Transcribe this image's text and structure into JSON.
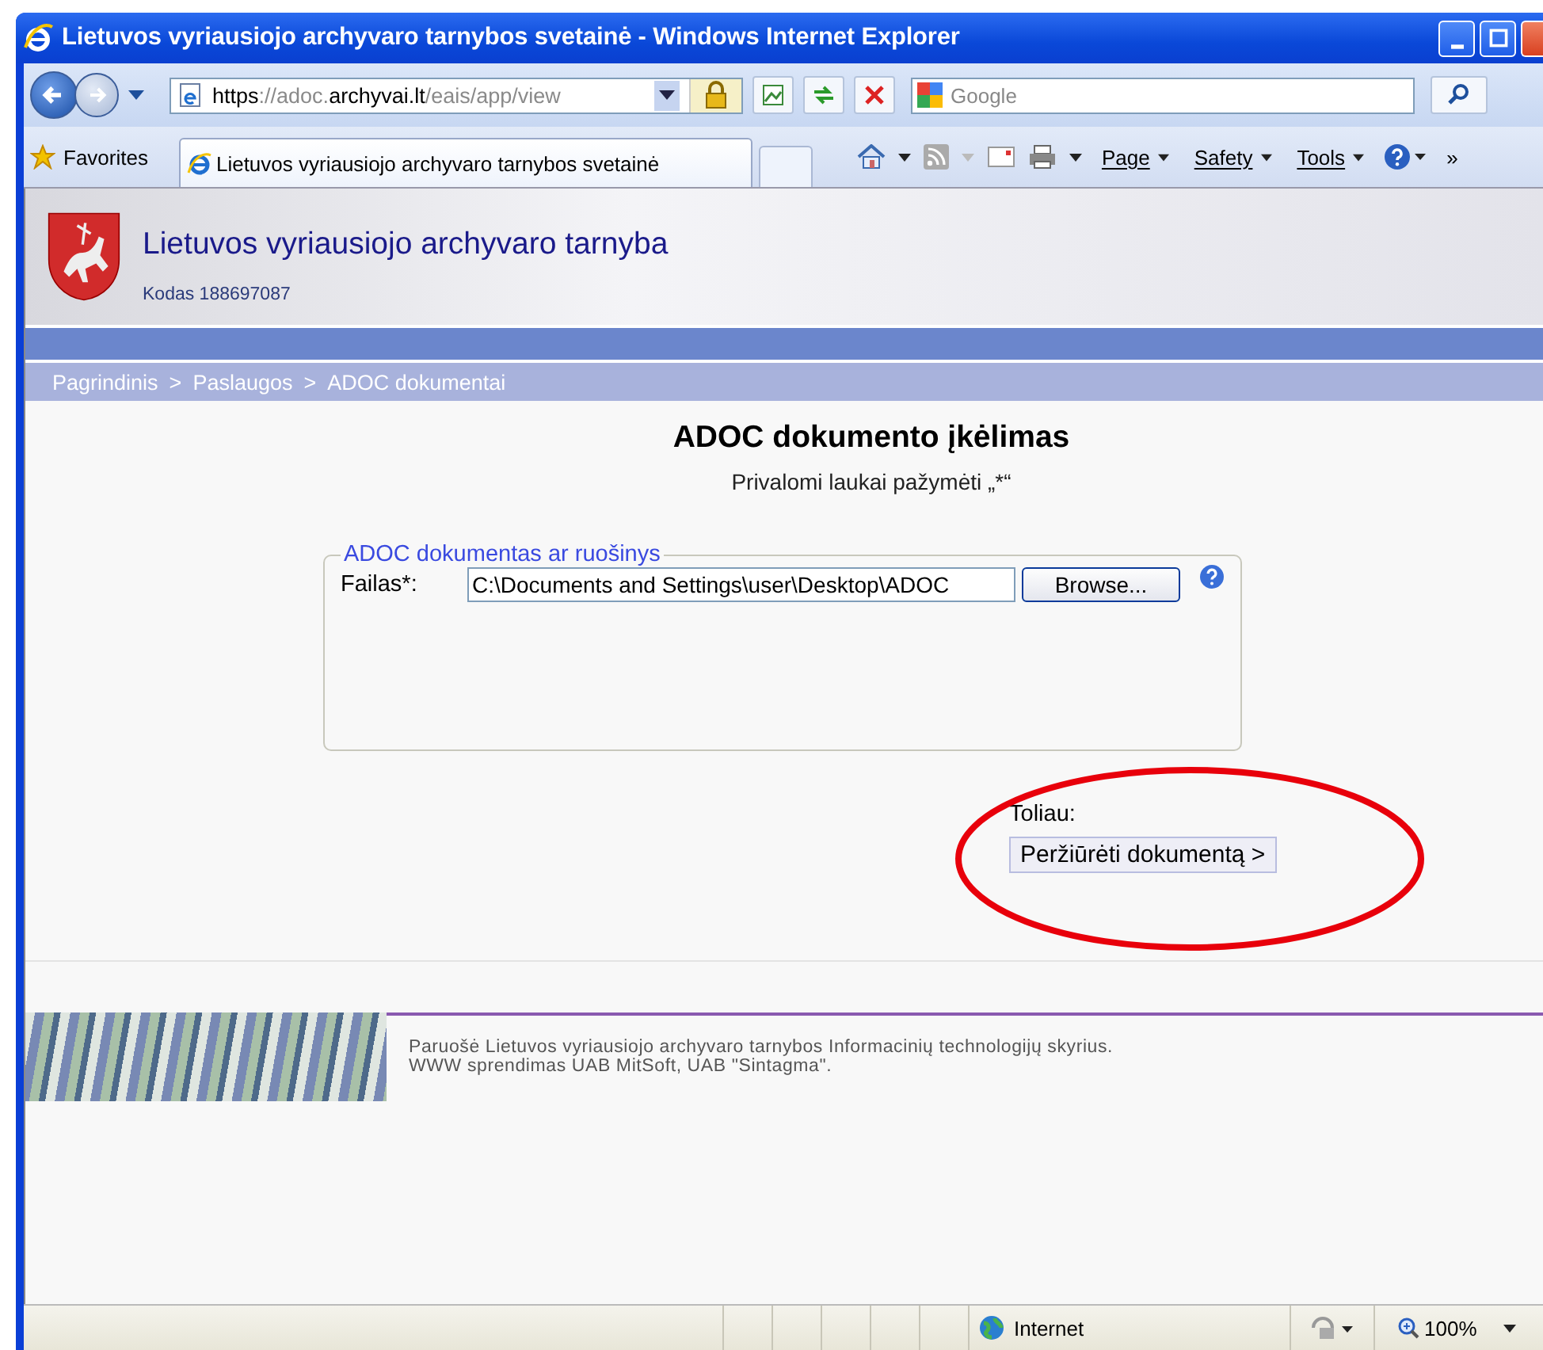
{
  "window": {
    "title": "Lietuvos vyriausiojo archyvaro tarnybos svetainė - Windows Internet Explorer"
  },
  "address_bar": {
    "url_parts": [
      {
        "text": "https",
        "strong": true
      },
      {
        "text": "://adoc.",
        "strong": false
      },
      {
        "text": "archyvai.lt",
        "strong": true
      },
      {
        "text": "/eais/app/view",
        "strong": false
      }
    ]
  },
  "search": {
    "placeholder": "Google"
  },
  "favorites": {
    "label": "Favorites"
  },
  "tabs": [
    {
      "label": "Lietuvos vyriausiojo archyvaro tarnybos svetainė",
      "selected": true
    }
  ],
  "command_bar": [
    {
      "label": "Page"
    },
    {
      "label": "Safety"
    },
    {
      "label": "Tools"
    }
  ],
  "command_more": "»",
  "site_header": {
    "title": "Lietuvos vyriausiojo archyvaro tarnyba",
    "code": "Kodas 188697087"
  },
  "breadcrumbs": [
    "Pagrindinis",
    "Paslaugos",
    "ADOC dokumentai"
  ],
  "breadcrumb_separator": ">",
  "page": {
    "heading": "ADOC dokumento įkėlimas",
    "note": "Privalomi laukai pažymėti „*“"
  },
  "fieldset": {
    "legend": "ADOC dokumentas ar ruošinys",
    "field_label": "Failas*:",
    "field_value": "C:\\Documents and Settings\\user\\Desktop\\ADOC",
    "browse_button": "Browse..."
  },
  "next": {
    "label": "Toliau:",
    "button": "Peržiūrėti dokumentą >"
  },
  "footer": {
    "lines": [
      "Paruošė Lietuvos vyriausiojo archyvaro tarnybos Informacinių technologijų skyrius.",
      "WWW sprendimas UAB MitSoft, UAB \"Sintagma\"."
    ]
  },
  "status_bar": {
    "zone": "Internet",
    "zoom": "100%"
  }
}
